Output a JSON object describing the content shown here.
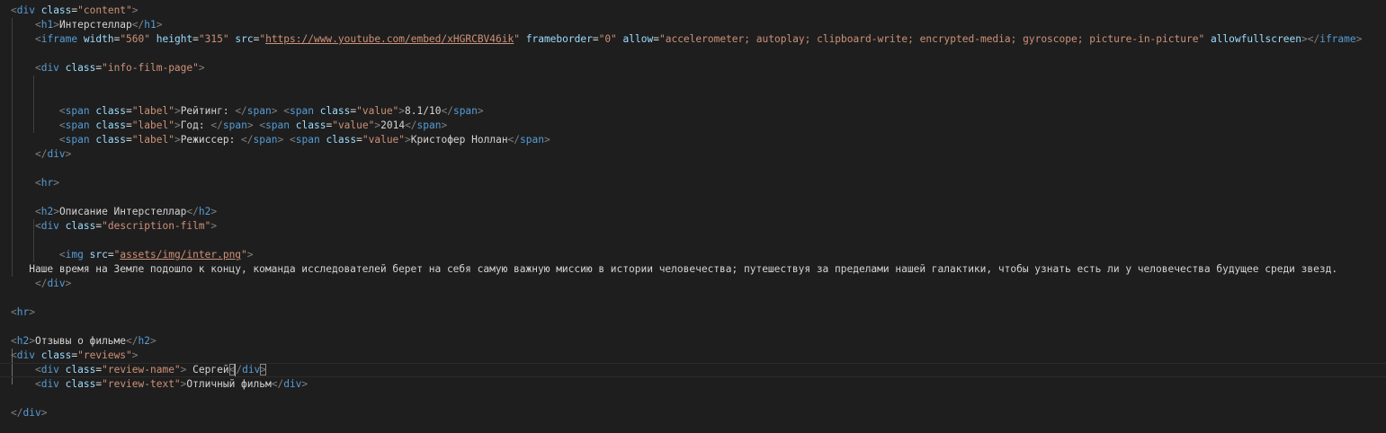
{
  "editor": {
    "language": "html",
    "colors": {
      "background": "#1e1e1e",
      "tag": "#569cd6",
      "punctuation": "#808080",
      "attribute": "#9cdcfe",
      "string": "#ce9178",
      "text": "#d4d4d4"
    },
    "lines": [
      [
        [
          "punct",
          "<"
        ],
        [
          "tag",
          "div"
        ],
        [
          "text",
          " "
        ],
        [
          "attr",
          "class"
        ],
        [
          "eq",
          "="
        ],
        [
          "str",
          "\"content\""
        ],
        [
          "punct",
          ">"
        ]
      ],
      [
        [
          "text",
          "    "
        ],
        [
          "punct",
          "<"
        ],
        [
          "tag",
          "h1"
        ],
        [
          "punct",
          ">"
        ],
        [
          "text",
          "Интерстеллар"
        ],
        [
          "punct",
          "</"
        ],
        [
          "tag",
          "h1"
        ],
        [
          "punct",
          ">"
        ]
      ],
      [
        [
          "text",
          "    "
        ],
        [
          "punct",
          "<"
        ],
        [
          "tag",
          "iframe"
        ],
        [
          "text",
          " "
        ],
        [
          "attr",
          "width"
        ],
        [
          "eq",
          "="
        ],
        [
          "str",
          "\"560\""
        ],
        [
          "text",
          " "
        ],
        [
          "attr",
          "height"
        ],
        [
          "eq",
          "="
        ],
        [
          "str",
          "\"315\""
        ],
        [
          "text",
          " "
        ],
        [
          "attr",
          "src"
        ],
        [
          "eq",
          "="
        ],
        [
          "str",
          "\""
        ],
        [
          "link",
          "https://www.youtube.com/embed/xHGRCBV46ik"
        ],
        [
          "str",
          "\""
        ],
        [
          "text",
          " "
        ],
        [
          "attr",
          "frameborder"
        ],
        [
          "eq",
          "="
        ],
        [
          "str",
          "\"0\""
        ],
        [
          "text",
          " "
        ],
        [
          "attr",
          "allow"
        ],
        [
          "eq",
          "="
        ],
        [
          "str",
          "\"accelerometer; autoplay; clipboard-write; encrypted-media; gyroscope; picture-in-picture\""
        ],
        [
          "text",
          " "
        ],
        [
          "attr",
          "allowfullscreen"
        ],
        [
          "punct",
          "></"
        ],
        [
          "tag",
          "iframe"
        ],
        [
          "punct",
          ">"
        ]
      ],
      [],
      [
        [
          "text",
          "    "
        ],
        [
          "punct",
          "<"
        ],
        [
          "tag",
          "div"
        ],
        [
          "text",
          " "
        ],
        [
          "attr",
          "class"
        ],
        [
          "eq",
          "="
        ],
        [
          "str",
          "\"info-film-page\""
        ],
        [
          "punct",
          ">"
        ]
      ],
      [],
      [],
      [
        [
          "text",
          "        "
        ],
        [
          "punct",
          "<"
        ],
        [
          "tag",
          "span"
        ],
        [
          "text",
          " "
        ],
        [
          "attr",
          "class"
        ],
        [
          "eq",
          "="
        ],
        [
          "str",
          "\"label\""
        ],
        [
          "punct",
          ">"
        ],
        [
          "text",
          "Рейтинг: "
        ],
        [
          "punct",
          "</"
        ],
        [
          "tag",
          "span"
        ],
        [
          "punct",
          ">"
        ],
        [
          "text",
          " "
        ],
        [
          "punct",
          "<"
        ],
        [
          "tag",
          "span"
        ],
        [
          "text",
          " "
        ],
        [
          "attr",
          "class"
        ],
        [
          "eq",
          "="
        ],
        [
          "str",
          "\"value\""
        ],
        [
          "punct",
          ">"
        ],
        [
          "text",
          "8.1/10"
        ],
        [
          "punct",
          "</"
        ],
        [
          "tag",
          "span"
        ],
        [
          "punct",
          ">"
        ]
      ],
      [
        [
          "text",
          "        "
        ],
        [
          "punct",
          "<"
        ],
        [
          "tag",
          "span"
        ],
        [
          "text",
          " "
        ],
        [
          "attr",
          "class"
        ],
        [
          "eq",
          "="
        ],
        [
          "str",
          "\"label\""
        ],
        [
          "punct",
          ">"
        ],
        [
          "text",
          "Год: "
        ],
        [
          "punct",
          "</"
        ],
        [
          "tag",
          "span"
        ],
        [
          "punct",
          ">"
        ],
        [
          "text",
          " "
        ],
        [
          "punct",
          "<"
        ],
        [
          "tag",
          "span"
        ],
        [
          "text",
          " "
        ],
        [
          "attr",
          "class"
        ],
        [
          "eq",
          "="
        ],
        [
          "str",
          "\"value\""
        ],
        [
          "punct",
          ">"
        ],
        [
          "text",
          "2014"
        ],
        [
          "punct",
          "</"
        ],
        [
          "tag",
          "span"
        ],
        [
          "punct",
          ">"
        ]
      ],
      [
        [
          "text",
          "        "
        ],
        [
          "punct",
          "<"
        ],
        [
          "tag",
          "span"
        ],
        [
          "text",
          " "
        ],
        [
          "attr",
          "class"
        ],
        [
          "eq",
          "="
        ],
        [
          "str",
          "\"label\""
        ],
        [
          "punct",
          ">"
        ],
        [
          "text",
          "Режиссер: "
        ],
        [
          "punct",
          "</"
        ],
        [
          "tag",
          "span"
        ],
        [
          "punct",
          ">"
        ],
        [
          "text",
          " "
        ],
        [
          "punct",
          "<"
        ],
        [
          "tag",
          "span"
        ],
        [
          "text",
          " "
        ],
        [
          "attr",
          "class"
        ],
        [
          "eq",
          "="
        ],
        [
          "str",
          "\"value\""
        ],
        [
          "punct",
          ">"
        ],
        [
          "text",
          "Кристофер Ноллан"
        ],
        [
          "punct",
          "</"
        ],
        [
          "tag",
          "span"
        ],
        [
          "punct",
          ">"
        ]
      ],
      [
        [
          "text",
          "    "
        ],
        [
          "punct",
          "</"
        ],
        [
          "tag",
          "div"
        ],
        [
          "punct",
          ">"
        ]
      ],
      [],
      [
        [
          "text",
          "    "
        ],
        [
          "punct",
          "<"
        ],
        [
          "tag",
          "hr"
        ],
        [
          "punct",
          ">"
        ]
      ],
      [],
      [
        [
          "text",
          "    "
        ],
        [
          "punct",
          "<"
        ],
        [
          "tag",
          "h2"
        ],
        [
          "punct",
          ">"
        ],
        [
          "text",
          "Описание Интерстеллар"
        ],
        [
          "punct",
          "</"
        ],
        [
          "tag",
          "h2"
        ],
        [
          "punct",
          ">"
        ]
      ],
      [
        [
          "text",
          "    "
        ],
        [
          "punct",
          "<"
        ],
        [
          "tag",
          "div"
        ],
        [
          "text",
          " "
        ],
        [
          "attr",
          "class"
        ],
        [
          "eq",
          "="
        ],
        [
          "str",
          "\"description-film\""
        ],
        [
          "punct",
          ">"
        ]
      ],
      [],
      [
        [
          "text",
          "        "
        ],
        [
          "punct",
          "<"
        ],
        [
          "tag",
          "img"
        ],
        [
          "text",
          " "
        ],
        [
          "attr",
          "src"
        ],
        [
          "eq",
          "="
        ],
        [
          "str",
          "\""
        ],
        [
          "link",
          "assets/img/inter.png"
        ],
        [
          "str",
          "\""
        ],
        [
          "punct",
          ">"
        ]
      ],
      [
        [
          "text",
          "   Наше время на Земле подошло к концу, команда исследователей берет на себя самую важную миссию в истории человечества; путешествуя за пределами нашей галактики, чтобы узнать есть ли у человечества будущее среди звезд."
        ]
      ],
      [
        [
          "text",
          "    "
        ],
        [
          "punct",
          "</"
        ],
        [
          "tag",
          "div"
        ],
        [
          "punct",
          ">"
        ]
      ],
      [],
      [
        [
          "punct",
          "<"
        ],
        [
          "tag",
          "hr"
        ],
        [
          "punct",
          ">"
        ]
      ],
      [],
      [
        [
          "punct",
          "<"
        ],
        [
          "tag",
          "h2"
        ],
        [
          "punct",
          ">"
        ],
        [
          "text",
          "Отзывы о фильме"
        ],
        [
          "punct",
          "</"
        ],
        [
          "tag",
          "h2"
        ],
        [
          "punct",
          ">"
        ]
      ],
      [
        [
          "punct",
          "<"
        ],
        [
          "tag",
          "div"
        ],
        [
          "text",
          " "
        ],
        [
          "attr",
          "class"
        ],
        [
          "eq",
          "="
        ],
        [
          "str",
          "\"reviews\""
        ],
        [
          "punct",
          ">"
        ]
      ],
      [
        [
          "text",
          "    "
        ],
        [
          "punct",
          "<"
        ],
        [
          "tag",
          "div"
        ],
        [
          "text",
          " "
        ],
        [
          "attr",
          "class"
        ],
        [
          "eq",
          "="
        ],
        [
          "str",
          "\"review-name\""
        ],
        [
          "punct",
          ">"
        ],
        [
          "text",
          " Сергей"
        ],
        [
          "bracket",
          "<"
        ],
        [
          "punct",
          "/"
        ],
        [
          "tag",
          "div"
        ],
        [
          "bracket",
          ">"
        ]
      ],
      [
        [
          "text",
          "    "
        ],
        [
          "punct",
          "<"
        ],
        [
          "tag",
          "div"
        ],
        [
          "text",
          " "
        ],
        [
          "attr",
          "class"
        ],
        [
          "eq",
          "="
        ],
        [
          "str",
          "\"review-text\""
        ],
        [
          "punct",
          ">"
        ],
        [
          "text",
          "Отличный фильм"
        ],
        [
          "punct",
          "</"
        ],
        [
          "tag",
          "div"
        ],
        [
          "punct",
          ">"
        ]
      ],
      [],
      [
        [
          "punct",
          "</"
        ],
        [
          "tag",
          "div"
        ],
        [
          "punct",
          ">"
        ]
      ],
      [],
      [
        [
          "punct",
          "</"
        ],
        [
          "tag",
          "div"
        ],
        [
          "punct",
          ">"
        ]
      ]
    ]
  }
}
